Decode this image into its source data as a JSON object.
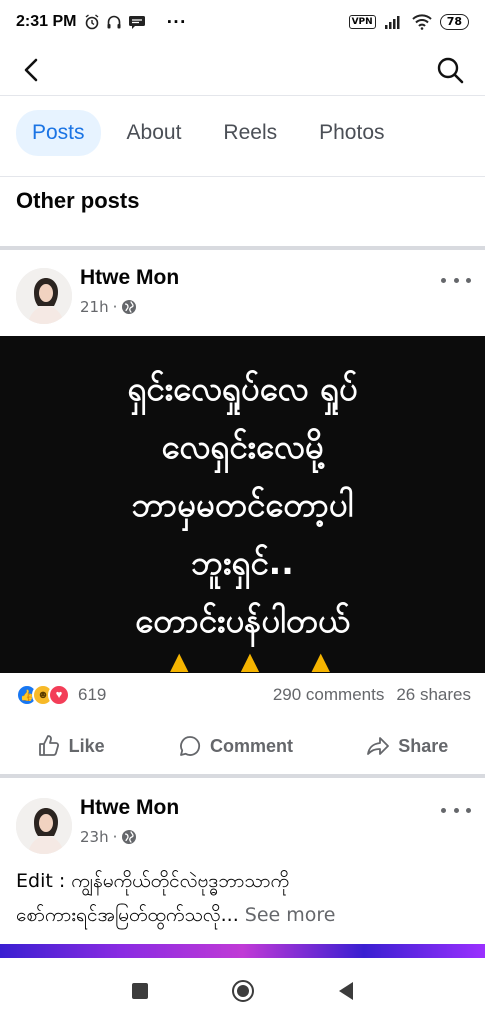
{
  "status_bar": {
    "time": "2:31 PM",
    "vpn": "VPN",
    "battery": "78"
  },
  "tabs": [
    {
      "label": "Posts",
      "active": true
    },
    {
      "label": "About",
      "active": false
    },
    {
      "label": "Reels",
      "active": false
    },
    {
      "label": "Photos",
      "active": false
    }
  ],
  "section_title": "Other posts",
  "posts": [
    {
      "author": "Htwe Mon",
      "time": "21h",
      "privacy_icon": "globe-icon",
      "image_text": [
        "ရှင်းလေရှုပ်လေ ရှုပ်",
        "လေရှင်းလေမို့",
        "ဘာမှမတင်တော့ပါ",
        "ဘူးရှင်..",
        "တောင်းပန်ပါတယ်"
      ],
      "reactions": [
        "like",
        "haha",
        "love"
      ],
      "reaction_count": "619",
      "comments": "290 comments",
      "shares": "26 shares"
    },
    {
      "author": "Htwe Mon",
      "time": "23h",
      "privacy_icon": "globe-icon",
      "caption_line1": "Edit : ကျွန်မကိုယ်တိုင်လဲဗုဒ္ဓဘာသာကို",
      "caption_line2": "စော်ကားရင်အမြတ်ထွက်သလို...",
      "see_more": "See more"
    }
  ],
  "actions": {
    "like": "Like",
    "comment": "Comment",
    "share": "Share"
  },
  "colors": {
    "accent": "#1b74e4",
    "tab_active_bg": "#e7f3ff",
    "muted": "#65676b"
  }
}
